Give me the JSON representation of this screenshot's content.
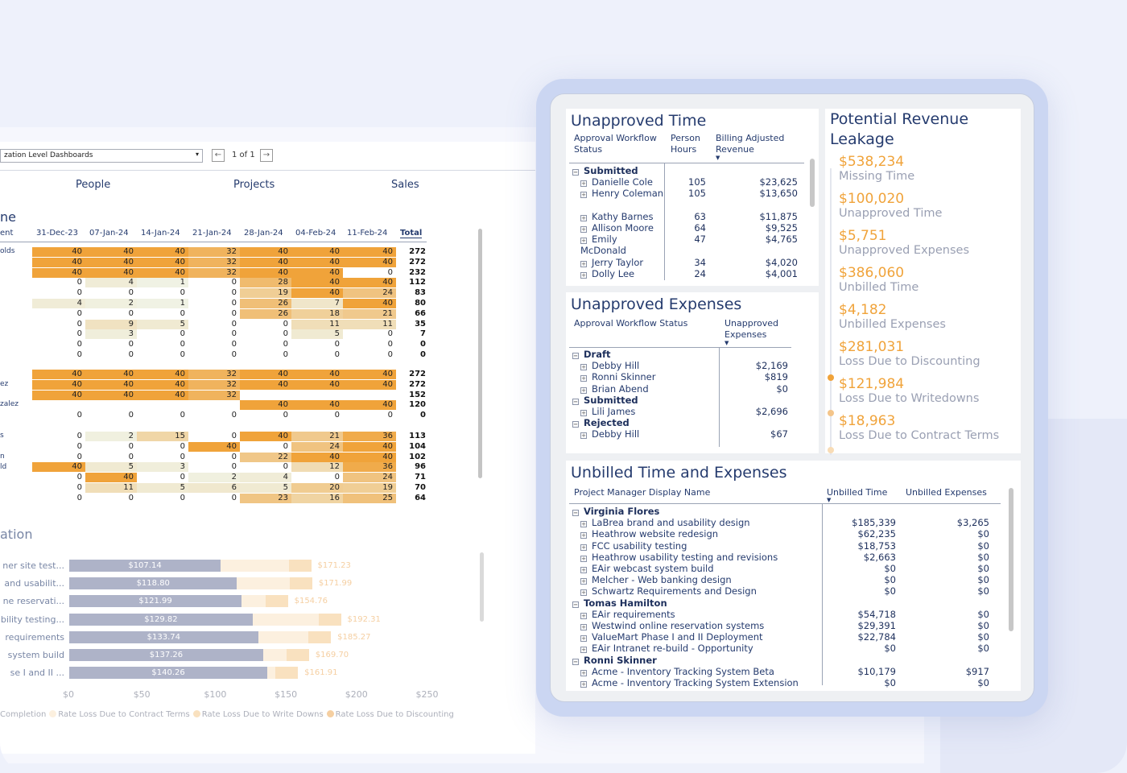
{
  "left": {
    "selector": "zation Level Dashboards",
    "pager": "1 of 1",
    "tabs": [
      "People",
      "Projects",
      "Sales"
    ],
    "heatmap": {
      "title": "ne",
      "first_col": "ent",
      "dates": [
        "31-Dec-23",
        "07-Jan-24",
        "14-Jan-24",
        "21-Jan-24",
        "28-Jan-24",
        "04-Feb-24",
        "11-Feb-24"
      ],
      "total_label": "Total",
      "names": [
        "olds",
        "",
        "",
        "",
        "",
        "",
        "",
        "",
        "",
        "",
        "",
        "",
        "",
        "ez",
        "zalez",
        "",
        "s",
        "n",
        "ld",
        "",
        "",
        ""
      ],
      "rows": [
        [
          40,
          40,
          40,
          32,
          40,
          40,
          40,
          272
        ],
        [
          40,
          40,
          40,
          32,
          40,
          40,
          40,
          272
        ],
        [
          40,
          40,
          40,
          32,
          40,
          40,
          0,
          232
        ],
        [
          0,
          4,
          1,
          0,
          28,
          40,
          40,
          112
        ],
        [
          0,
          0,
          0,
          0,
          19,
          40,
          24,
          83
        ],
        [
          4,
          2,
          1,
          0,
          26,
          7,
          40,
          80
        ],
        [
          0,
          0,
          0,
          0,
          26,
          18,
          21,
          66
        ],
        [
          0,
          9,
          5,
          0,
          0,
          11,
          11,
          35
        ],
        [
          0,
          3,
          0,
          0,
          0,
          5,
          0,
          7
        ],
        [
          0,
          0,
          0,
          0,
          0,
          0,
          0,
          0
        ],
        [
          0,
          0,
          0,
          0,
          0,
          0,
          0,
          0
        ]
      ],
      "rows2": [
        [
          40,
          40,
          40,
          32,
          40,
          40,
          40,
          272
        ],
        [
          40,
          40,
          40,
          32,
          40,
          40,
          40,
          272
        ],
        [
          40,
          40,
          40,
          32,
          null,
          null,
          null,
          152
        ],
        [
          null,
          null,
          null,
          null,
          40,
          40,
          40,
          120
        ],
        [
          0,
          0,
          0,
          0,
          0,
          0,
          0,
          0
        ]
      ],
      "rows3": [
        [
          0,
          2,
          15,
          0,
          40,
          21,
          36,
          113
        ],
        [
          0,
          0,
          0,
          40,
          0,
          24,
          40,
          104
        ],
        [
          0,
          0,
          0,
          0,
          22,
          40,
          40,
          102
        ],
        [
          40,
          5,
          3,
          0,
          0,
          12,
          36,
          96
        ],
        [
          0,
          40,
          0,
          2,
          4,
          0,
          24,
          71
        ],
        [
          0,
          11,
          5,
          6,
          5,
          20,
          19,
          70
        ],
        [
          0,
          0,
          0,
          0,
          23,
          16,
          25,
          64
        ]
      ]
    },
    "utilization": {
      "title": "ation",
      "bars": [
        {
          "label": "ner site test...",
          "value": "$107.14",
          "ext": "$171.23"
        },
        {
          "label": "and usabilit...",
          "value": "$118.80",
          "ext": "$171.99"
        },
        {
          "label": "ne reservati...",
          "value": "$121.99",
          "ext": "$154.76"
        },
        {
          "label": "bility testing...",
          "value": "$129.82",
          "ext": "$192.31"
        },
        {
          "label": "requirements",
          "value": "$133.74",
          "ext": "$185.27"
        },
        {
          "label": "system build",
          "value": "$137.26",
          "ext": "$169.70"
        },
        {
          "label": "se I and II ...",
          "value": "$140.26",
          "ext": "$161.91"
        }
      ],
      "ticks": [
        "$0",
        "$50",
        "$100",
        "$150",
        "$200",
        "$250"
      ],
      "legend": [
        "Completion",
        "Rate Loss Due to Contract Terms",
        "Rate Loss Due to Write Downs",
        "Rate Loss Due to Discounting"
      ]
    }
  },
  "unapproved_time": {
    "title": "Unapproved Time",
    "headers": [
      "Approval Workflow Status",
      "Person Hours",
      "Billing Adjusted Revenue"
    ],
    "group": "Submitted",
    "rows": [
      {
        "name": "Danielle Cole",
        "hours": "105",
        "rev": "$23,625"
      },
      {
        "name": "Henry Coleman",
        "hours": "105",
        "rev": "$13,650"
      },
      {
        "name": "Kathy Barnes",
        "hours": "63",
        "rev": "$11,875"
      },
      {
        "name": "Allison Moore",
        "hours": "64",
        "rev": "$9,525"
      },
      {
        "name": "Emily McDonald",
        "hours": "47",
        "rev": "$4,765"
      },
      {
        "name": "Jerry Taylor",
        "hours": "34",
        "rev": "$4,020"
      },
      {
        "name": "Dolly Lee",
        "hours": "24",
        "rev": "$4,001"
      }
    ]
  },
  "unapproved_expenses": {
    "title": "Unapproved Expenses",
    "headers": [
      "Approval Workflow Status",
      "Unapproved Expenses"
    ],
    "groups": [
      {
        "name": "Draft",
        "rows": [
          {
            "name": "Debby Hill",
            "val": "$2,169"
          },
          {
            "name": "Ronni Skinner",
            "val": "$819"
          },
          {
            "name": "Brian Abend",
            "val": "$0"
          }
        ]
      },
      {
        "name": "Submitted",
        "rows": [
          {
            "name": "Lili James",
            "val": "$2,696"
          }
        ]
      },
      {
        "name": "Rejected",
        "rows": [
          {
            "name": "Debby Hill",
            "val": "$67"
          }
        ]
      }
    ]
  },
  "leakage": {
    "title": "Potential Revenue Leakage",
    "items": [
      {
        "amount": "$538,234",
        "label": "Missing Time"
      },
      {
        "amount": "$100,020",
        "label": "Unapproved Time"
      },
      {
        "amount": "$5,751",
        "label": "Unapproved Expenses"
      },
      {
        "amount": "$386,060",
        "label": "Unbilled Time"
      },
      {
        "amount": "$4,182",
        "label": "Unbilled Expenses"
      },
      {
        "amount": "$281,031",
        "label": "Loss Due to Discounting"
      },
      {
        "amount": "$121,984",
        "label": "Loss Due to Writedowns"
      },
      {
        "amount": "$18,963",
        "label": "Loss Due to Contract Terms"
      }
    ],
    "dot_colors": [
      "#f0a33a",
      "#f4c58a",
      "#f8dcb6"
    ]
  },
  "unbilled": {
    "title": "Unbilled Time and Expenses",
    "headers": [
      "Project Manager Display Name",
      "Unbilled Time",
      "Unbilled Expenses"
    ],
    "groups": [
      {
        "name": "Virginia Flores",
        "rows": [
          {
            "name": "LaBrea brand and usability design",
            "time": "$185,339",
            "exp": "$3,265"
          },
          {
            "name": "Heathrow website redesign",
            "time": "$62,235",
            "exp": "$0"
          },
          {
            "name": "FCC usability testing",
            "time": "$18,753",
            "exp": "$0"
          },
          {
            "name": "Heathrow usability testing and revisions",
            "time": "$2,663",
            "exp": "$0"
          },
          {
            "name": "EAir webcast system build",
            "time": "$0",
            "exp": "$0"
          },
          {
            "name": "Melcher - Web banking design",
            "time": "$0",
            "exp": "$0"
          },
          {
            "name": "Schwartz Requirements and Design",
            "time": "$0",
            "exp": "$0"
          }
        ]
      },
      {
        "name": "Tomas Hamilton",
        "rows": [
          {
            "name": "EAir requirements",
            "time": "$54,718",
            "exp": "$0"
          },
          {
            "name": "Westwind online reservation systems",
            "time": "$29,391",
            "exp": "$0"
          },
          {
            "name": "ValueMart Phase I and II Deployment",
            "time": "$22,784",
            "exp": "$0"
          },
          {
            "name": "EAir Intranet re-build - Opportunity",
            "time": "$0",
            "exp": "$0"
          }
        ]
      },
      {
        "name": "Ronni Skinner",
        "rows": [
          {
            "name": "Acme - Inventory Tracking System Beta",
            "time": "$10,179",
            "exp": "$917"
          },
          {
            "name": "Acme - Inventory Tracking System Extension",
            "time": "$0",
            "exp": "$0"
          }
        ]
      }
    ]
  }
}
